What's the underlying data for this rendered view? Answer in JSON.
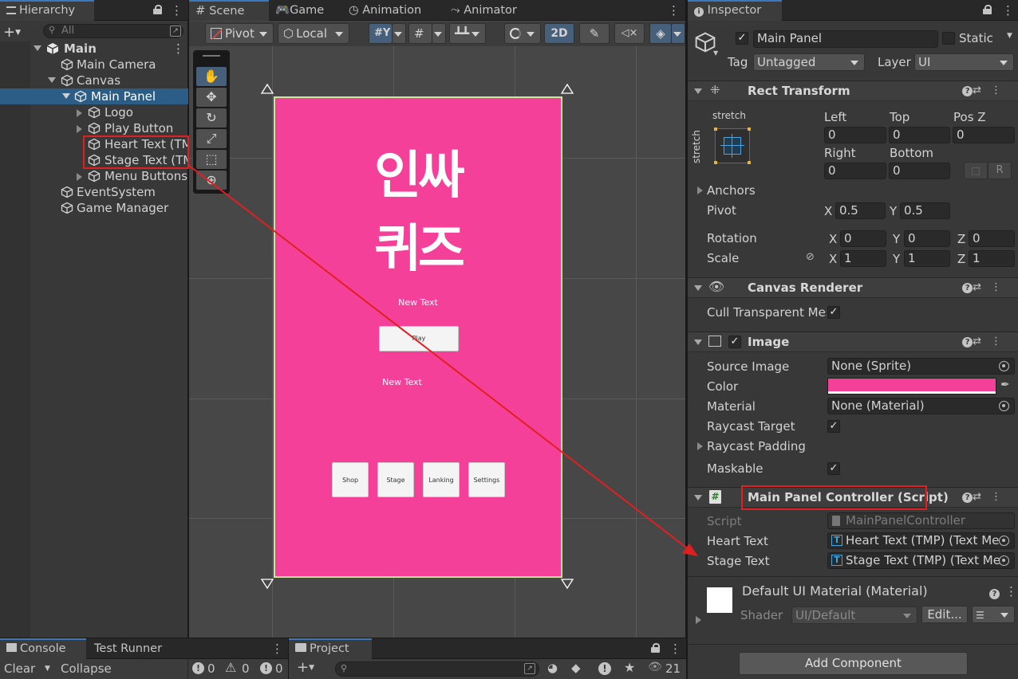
{
  "hierarchy": {
    "tab": "Hierarchy",
    "search_placeholder": "All",
    "add_label": "+",
    "items": [
      {
        "label": "Main",
        "level": 0
      },
      {
        "label": "Main Camera",
        "level": 1
      },
      {
        "label": "Canvas",
        "level": 1
      },
      {
        "label": "Main Panel",
        "level": 2
      },
      {
        "label": "Logo",
        "level": 3
      },
      {
        "label": "Play Button",
        "level": 3
      },
      {
        "label": "Heart Text (TM",
        "level": 3
      },
      {
        "label": "Stage Text (TM",
        "level": 3
      },
      {
        "label": "Menu Buttons",
        "level": 3
      },
      {
        "label": "EventSystem",
        "level": 1
      },
      {
        "label": "Game Manager",
        "level": 1
      }
    ]
  },
  "scene": {
    "tabs": [
      "Scene",
      "Game",
      "Animation",
      "Animator"
    ],
    "pivot_label": "Pivot",
    "local_label": "Local",
    "mode_2d": "2D",
    "panel": {
      "logo_line1": "인싸",
      "logo_line2": "퀴즈",
      "heart_text": "New Text",
      "play_label": "Play",
      "stage_text": "New Text",
      "menu_buttons": [
        "Shop",
        "Stage",
        "Lanking",
        "Settings"
      ],
      "color": "#f44098"
    }
  },
  "inspector": {
    "tab": "Inspector",
    "object_name": "Main Panel",
    "static_label": "Static",
    "tag_label": "Tag",
    "tag_value": "Untagged",
    "layer_label": "Layer",
    "layer_value": "UI",
    "rect_transform": {
      "title": "Rect Transform",
      "anchor_h": "stretch",
      "anchor_v": "stretch",
      "left_label": "Left",
      "left": "0",
      "top_label": "Top",
      "top": "0",
      "posz_label": "Pos Z",
      "posz": "0",
      "right_label": "Right",
      "right": "0",
      "bottom_label": "Bottom",
      "bottom": "0",
      "anchors_label": "Anchors",
      "pivot_label": "Pivot",
      "pivot_x": "0.5",
      "pivot_y": "0.5",
      "rotation_label": "Rotation",
      "rot_x": "0",
      "rot_y": "0",
      "rot_z": "0",
      "scale_label": "Scale",
      "scale_x": "1",
      "scale_y": "1",
      "scale_z": "1",
      "axis_x": "X",
      "axis_y": "Y",
      "axis_z": "Z"
    },
    "canvas_renderer": {
      "title": "Canvas Renderer",
      "cull_label": "Cull Transparent Mes"
    },
    "image": {
      "title": "Image",
      "source_label": "Source Image",
      "source_value": "None (Sprite)",
      "color_label": "Color",
      "color_value": "#f44098",
      "material_label": "Material",
      "material_value": "None (Material)",
      "raycast_label": "Raycast Target",
      "raycast_padding_label": "Raycast Padding",
      "maskable_label": "Maskable"
    },
    "script_component": {
      "title": "Main Panel Controller (Script)",
      "script_label": "Script",
      "script_value": "MainPanelController",
      "heart_label": "Heart Text",
      "heart_value": "Heart Text (TMP) (Text Me",
      "stage_label": "Stage Text",
      "stage_value": "Stage Text (TMP) (Text Me"
    },
    "material": {
      "title": "Default UI Material (Material)",
      "shader_label": "Shader",
      "shader_value": "UI/Default",
      "edit_label": "Edit..."
    },
    "add_component": "Add Component"
  },
  "console": {
    "tabs": [
      "Console",
      "Test Runner"
    ],
    "clear_label": "Clear",
    "collapse_label": "Collapse",
    "log_count": "0",
    "warn_count": "0",
    "error_count": "0"
  },
  "project": {
    "tab": "Project",
    "hidden_count": "21"
  }
}
